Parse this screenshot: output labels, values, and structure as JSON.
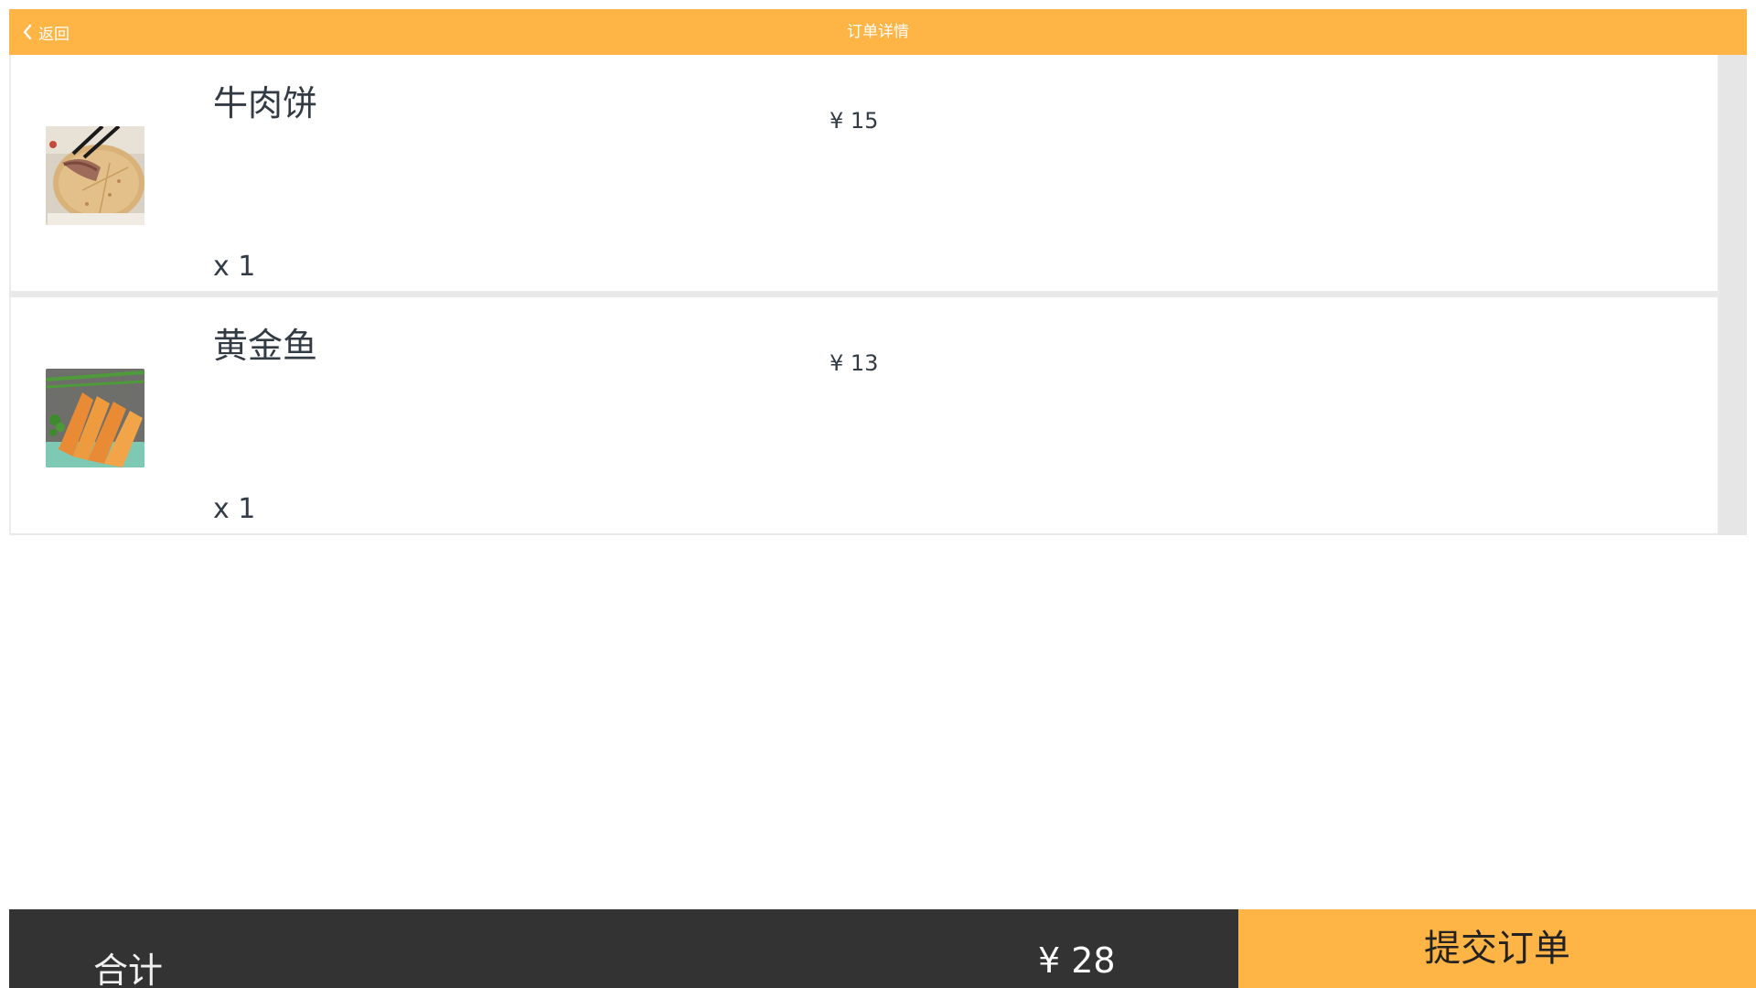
{
  "header": {
    "back_label": "返回",
    "title": "订单详情"
  },
  "order": {
    "items": [
      {
        "name": "牛肉饼",
        "price": "¥ 15",
        "quantity": "x 1",
        "image": "beef-pancake-photo"
      },
      {
        "name": "黄金鱼",
        "price": "¥ 13",
        "quantity": "x 1",
        "image": "golden-fried-fish-photo"
      }
    ]
  },
  "footer": {
    "total_label": "合计",
    "total_value": "¥ 28",
    "submit_label": "提交订单"
  },
  "colors": {
    "accent": "#FFB546",
    "footer_bg": "#333333",
    "text": "#333B45"
  },
  "icons": {
    "back": "chevron-left-icon"
  }
}
